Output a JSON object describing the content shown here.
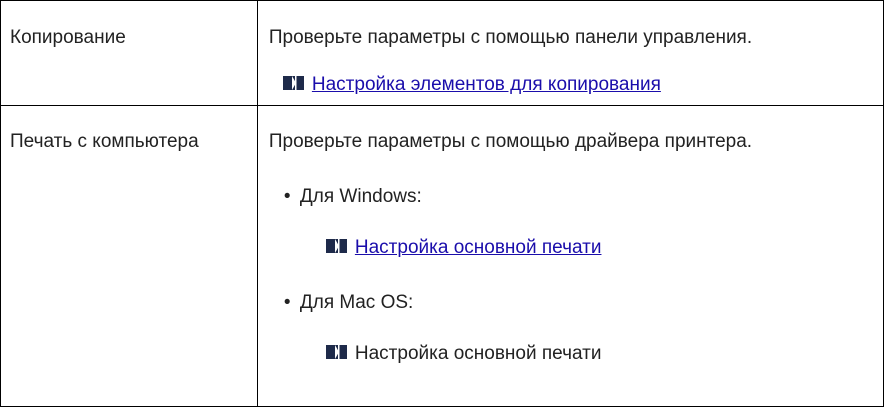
{
  "rows": [
    {
      "label": "Копирование",
      "description": "Проверьте параметры с помощью панели управления.",
      "link": "Настройка элементов для копирования"
    },
    {
      "label": "Печать с компьютера",
      "description": "Проверьте параметры с помощью драйвера принтера.",
      "bullets": [
        {
          "bullet_char": "•",
          "text": "Для Windows:",
          "link": "Настройка основной печати",
          "link_active": true
        },
        {
          "bullet_char": "•",
          "text": "Для Mac OS:",
          "link": "Настройка основной печати",
          "link_active": false
        }
      ]
    }
  ],
  "colors": {
    "link": "#1a0dab",
    "text": "#222222",
    "border": "#000000",
    "icon": "#1e2a4a"
  },
  "icons": {
    "reference": "reference-arrow-icon"
  }
}
